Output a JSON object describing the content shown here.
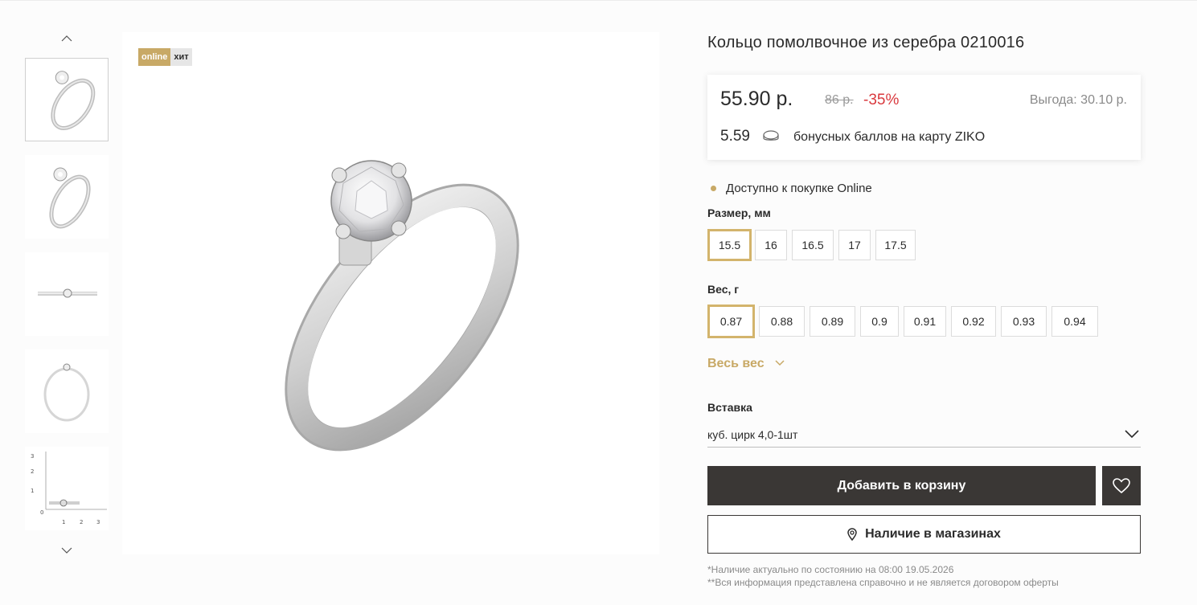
{
  "product": {
    "title": "Кольцо помолвочное из серебра 0210016",
    "badges": {
      "online": "online",
      "hit": "хит"
    }
  },
  "price": {
    "current": "55.90 р.",
    "old": "86 р.",
    "discount": "-35%",
    "benefit": "Выгода: 30.10 р.",
    "bonus_value": "5.59",
    "bonus_text": "бонусных баллов на карту ZIKO"
  },
  "availability": {
    "text": "Доступно к покупке Online",
    "dot_color": "#c8a966"
  },
  "size": {
    "label": "Размер, мм",
    "options": [
      "15.5",
      "16",
      "16.5",
      "17",
      "17.5"
    ],
    "selected": "15.5"
  },
  "weight": {
    "label": "Вес, г",
    "options": [
      "0.87",
      "0.88",
      "0.89",
      "0.9",
      "0.91",
      "0.92",
      "0.93",
      "0.94"
    ],
    "selected": "0.87",
    "all_label": "Весь вес"
  },
  "insert": {
    "label": "Вставка",
    "value": "куб. цирк 4,0-1шт"
  },
  "buttons": {
    "add_to_cart": "Добавить в корзину",
    "stores": "Наличие в магазинах"
  },
  "notes": {
    "availability_note": "*Наличие актуально по состоянию на 08:00 19.05.2026",
    "disclaimer": "**Вся информация представлена справочно и не является договором оферты"
  },
  "thumbnails": {
    "scale_ticks_x": [
      "0",
      "1",
      "2",
      "3"
    ],
    "scale_ticks_y": [
      "3",
      "2",
      "1"
    ]
  },
  "colors": {
    "accent_gold": "#c8a966",
    "dark_button": "#3a3735",
    "discount_red": "#d9393e"
  },
  "icons": {
    "up": "chevron-up-icon",
    "down": "chevron-down-icon",
    "coin": "coin-icon",
    "heart": "heart-icon",
    "pin": "location-pin-icon"
  }
}
